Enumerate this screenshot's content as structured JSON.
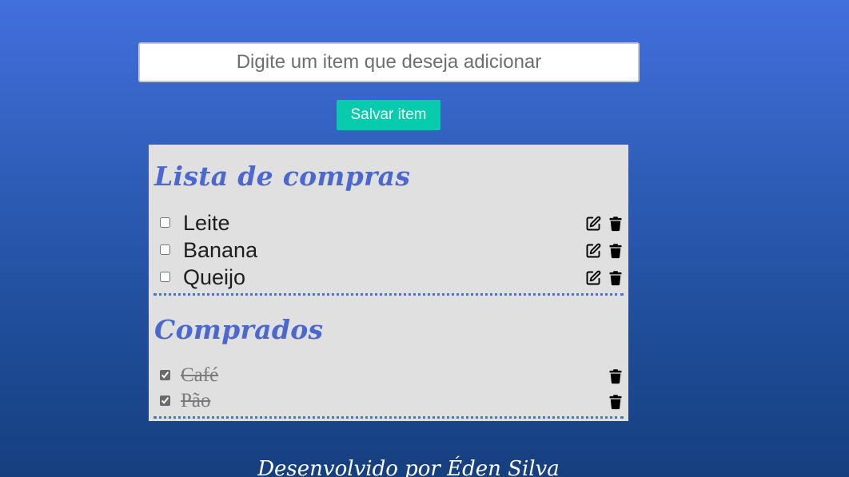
{
  "form": {
    "input_placeholder": "Digite um item que deseja adicionar",
    "input_value": "",
    "save_label": "Salvar item"
  },
  "pending_section": {
    "title": "Lista de compras",
    "items": [
      {
        "label": "Leite",
        "checked": false
      },
      {
        "label": "Banana",
        "checked": false
      },
      {
        "label": "Queijo",
        "checked": false
      }
    ]
  },
  "done_section": {
    "title": "Comprados",
    "items": [
      {
        "label": "Café",
        "checked": true
      },
      {
        "label": "Pão",
        "checked": true
      }
    ]
  },
  "footer": {
    "text": "Desenvolvido por Éden Silva"
  },
  "icons": {
    "edit": "pencil-square-icon",
    "delete": "trash-icon"
  },
  "colors": {
    "accent_button": "#06ccad",
    "title": "#4a68cf",
    "panel": "#e0e0e0",
    "divider": "#4a72d6"
  }
}
